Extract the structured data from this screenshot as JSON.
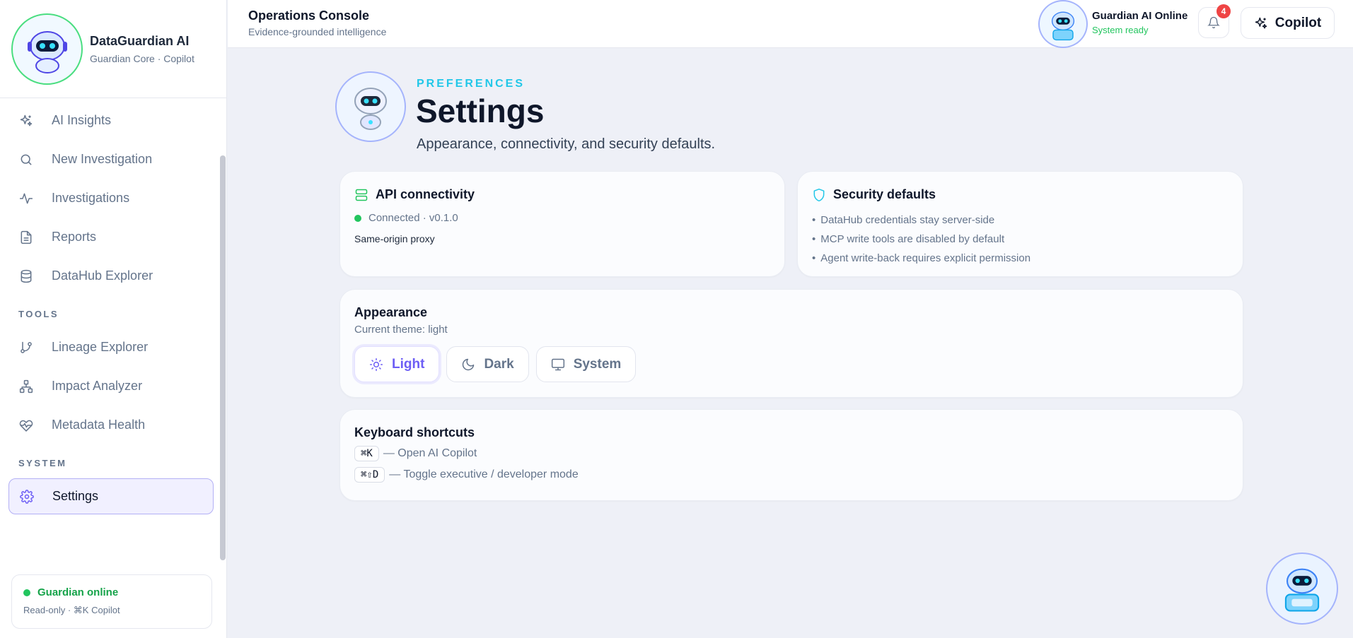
{
  "brand": {
    "title": "DataGuardian AI",
    "subtitle": "Guardian Core · Copilot"
  },
  "sidebar": {
    "items": [
      {
        "label": "AI Insights",
        "icon": "sparkles-icon"
      },
      {
        "label": "New Investigation",
        "icon": "search-icon"
      },
      {
        "label": "Investigations",
        "icon": "activity-icon"
      },
      {
        "label": "Reports",
        "icon": "file-text-icon"
      },
      {
        "label": "DataHub Explorer",
        "icon": "database-icon"
      }
    ],
    "tools_heading": "TOOLS",
    "tools": [
      {
        "label": "Lineage Explorer",
        "icon": "git-branch-icon"
      },
      {
        "label": "Impact Analyzer",
        "icon": "network-icon"
      },
      {
        "label": "Metadata Health",
        "icon": "heart-pulse-icon"
      }
    ],
    "system_heading": "SYSTEM",
    "system": [
      {
        "label": "Settings",
        "icon": "gear-icon",
        "active": true
      }
    ],
    "status": {
      "title": "Guardian online",
      "subtitle": "Read-only · ⌘K Copilot"
    }
  },
  "header": {
    "title": "Operations Console",
    "subtitle": "Evidence-grounded intelligence",
    "online_title": "Guardian AI Online",
    "online_subtitle": "System ready",
    "notification_count": "4",
    "copilot_label": "Copilot"
  },
  "page": {
    "eyebrow": "PREFERENCES",
    "title": "Settings",
    "subtitle": "Appearance, connectivity, and security defaults."
  },
  "api": {
    "title": "API connectivity",
    "status": "Connected · v0.1.0",
    "proxy": "Same-origin proxy"
  },
  "security": {
    "title": "Security defaults",
    "items": [
      "DataHub credentials stay server-side",
      "MCP write tools are disabled by default",
      "Agent write-back requires explicit permission"
    ]
  },
  "appearance": {
    "title": "Appearance",
    "current": "Current theme: light",
    "options": [
      {
        "label": "Light",
        "icon": "sun-icon",
        "selected": true
      },
      {
        "label": "Dark",
        "icon": "moon-icon",
        "selected": false
      },
      {
        "label": "System",
        "icon": "monitor-icon",
        "selected": false
      }
    ]
  },
  "shortcuts": {
    "title": "Keyboard shortcuts",
    "items": [
      {
        "keys": "⌘K",
        "desc": "— Open AI Copilot"
      },
      {
        "keys": "⌘⇧D",
        "desc": "— Toggle executive / developer mode"
      }
    ]
  },
  "colors": {
    "accent": "#6d5ef5",
    "success": "#22c55e",
    "eyebrow": "#22c7e8",
    "badge": "#ef4444"
  }
}
